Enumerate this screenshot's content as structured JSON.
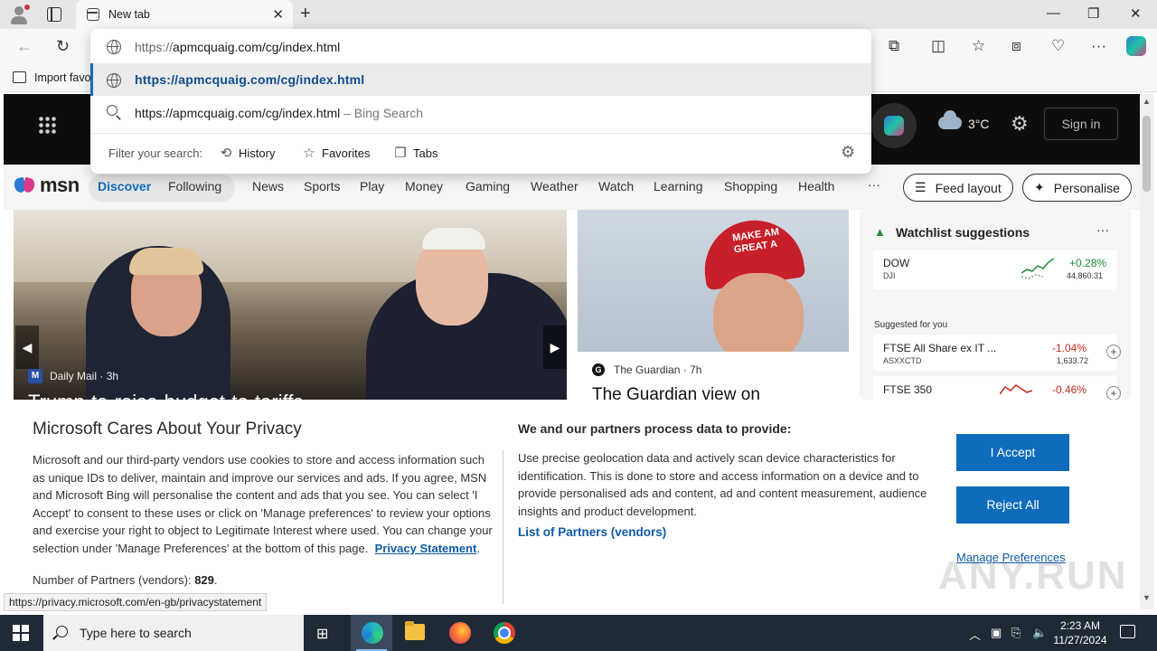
{
  "browser": {
    "tab_title": "New tab",
    "tab_close": "✕",
    "new_tab": "+",
    "window_controls": {
      "minimize": "—",
      "maximize": "❐",
      "close": "✕"
    },
    "favorites_bar": {
      "import_label": "Import favo"
    }
  },
  "omnibox": {
    "input_prefix": "https://",
    "input_rest": "apmcquaig.com/cg/index.html",
    "suggestion_url": "https://apmcquaig.com/cg/index.html",
    "search_text": "https://apmcquaig.com/cg/index.html",
    "search_suffix": " – Bing Search",
    "filter_label": "Filter your search:",
    "filters": [
      "History",
      "Favorites",
      "Tabs"
    ]
  },
  "msn": {
    "weather_temp": "3°C",
    "sign_in": "Sign in",
    "logo_text": "msn",
    "nav": [
      "Discover",
      "Following",
      "News",
      "Sports",
      "Play",
      "Money",
      "Gaming",
      "Weather",
      "Watch",
      "Learning",
      "Shopping",
      "Health"
    ],
    "more": "···",
    "feed_layout": "Feed layout",
    "personalise": "Personalise",
    "hero": {
      "source": "Daily Mail",
      "age": "· 3h",
      "badge": "M",
      "headline_peek": "Trump-to-raise-budget-to-tariffs..."
    },
    "card2": {
      "source": "The Guardian",
      "age": "· 7h",
      "headline_peek": "The Guardian view on",
      "cap_text": "MAKE AM\nGREAT A"
    },
    "watchlist": {
      "title": "Watchlist suggestions",
      "more": "···",
      "suggested_label": "Suggested for you",
      "stocks": [
        {
          "symbol": "DOW",
          "sub": "DJI",
          "change": "+0.28%",
          "value": "44,860.31",
          "direction": "up"
        },
        {
          "symbol": "FTSE All Share ex IT ...",
          "sub": "ASXXCTD",
          "change": "-1.04%",
          "value": "1,633.72",
          "direction": "down"
        },
        {
          "symbol": "FTSE 350",
          "sub": "",
          "change": "-0.46%",
          "value": "",
          "direction": "down"
        }
      ]
    }
  },
  "privacy": {
    "title": "Microsoft Cares About Your Privacy",
    "body": "Microsoft and our third-party vendors use cookies to store and access information such as unique IDs to deliver, maintain and improve our services and ads. If you agree, MSN and Microsoft Bing will personalise the content and ads that you see. You can select 'I Accept' to consent to these uses or click on 'Manage preferences' to review your options and exercise your right to object to Legitimate Interest where used.  You can change your selection under 'Manage Preferences' at the bottom of this page.",
    "privacy_link": "Privacy Statement",
    "partners_label": "Number of Partners (vendors): ",
    "partners_count": "829",
    "right_heading": "We and our partners process data to provide:",
    "right_body": "Use precise geolocation data and actively scan device characteristics for identification. This is done to store and access information on a device and to provide personalised ads and content, ad and content measurement, audience insights and product development.",
    "list_partners": "List of Partners (vendors)",
    "accept": "I Accept",
    "reject": "Reject All",
    "manage": "Manage Preferences",
    "watermark": "ANY.RUN"
  },
  "status_url": "https://privacy.microsoft.com/en-gb/privacystatement",
  "taskbar": {
    "search_placeholder": "Type here to search",
    "time": "2:23 AM",
    "date": "11/27/2024"
  },
  "colors": {
    "accent": "#0f6cbd",
    "up": "#1f8a3a",
    "down": "#c42b1c",
    "msn_header": "#0d0d0d",
    "taskbar": "#1f2a36"
  }
}
